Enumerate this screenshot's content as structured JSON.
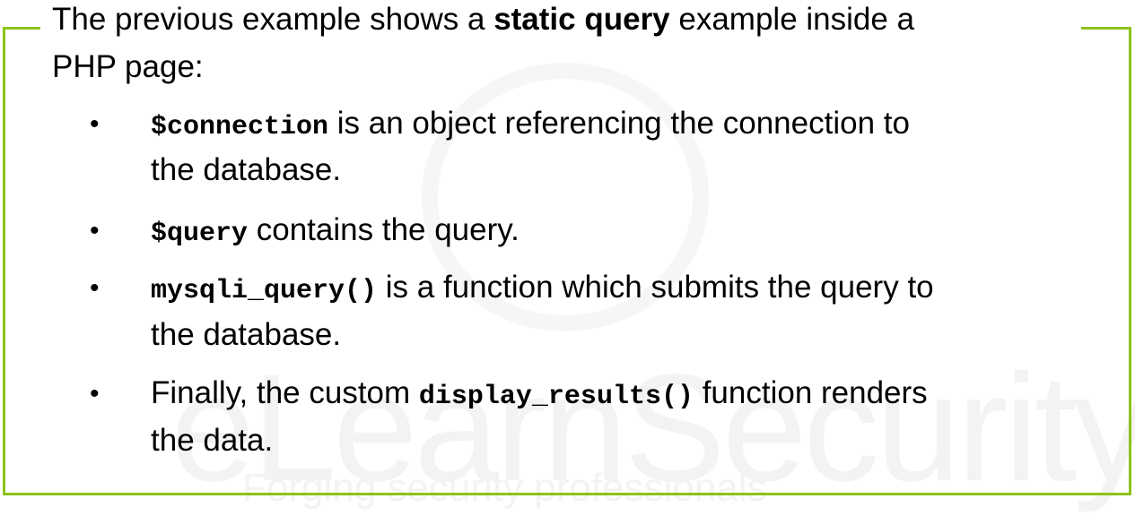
{
  "watermark": {
    "brand": "eLearnSecurity",
    "tagline": "Forging security professionals"
  },
  "colors": {
    "border": "#8cc31a"
  },
  "intro": {
    "pre": "The previous example shows a ",
    "bold": "static query",
    "post": " example inside a",
    "line2": "PHP page:"
  },
  "bullets": [
    {
      "code": "$connection",
      "text": " is an object referencing the connection to",
      "cont": "the database."
    },
    {
      "code": "$query",
      "text": " contains the query."
    },
    {
      "code": "mysqli_query()",
      "text": " is a function which submits the query to",
      "cont": "the database."
    },
    {
      "pre": "Finally, the custom ",
      "code": "display_results()",
      "text": " function renders",
      "cont": "the data."
    }
  ],
  "bullet_glyph": "•"
}
